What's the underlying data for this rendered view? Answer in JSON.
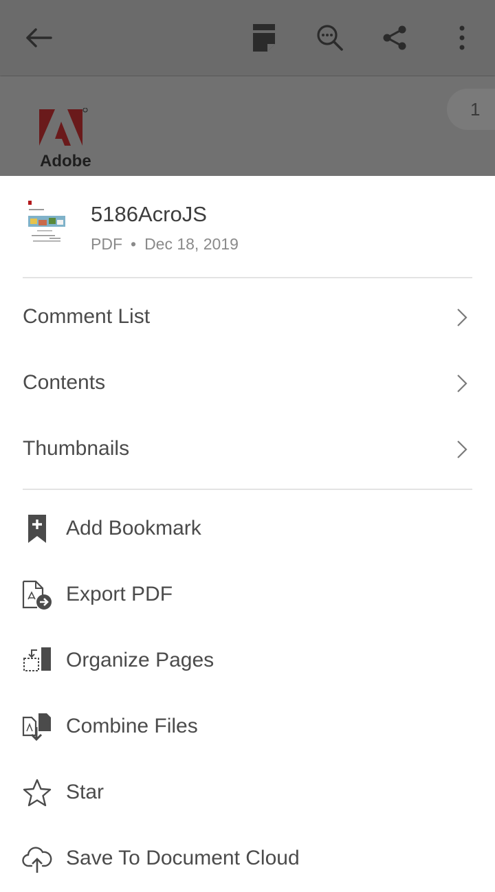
{
  "toolbar": {
    "back_icon": "arrow-left-icon",
    "icons": [
      "view-mode-icon",
      "search-icon",
      "share-icon",
      "more-vert-icon"
    ]
  },
  "document": {
    "logo_text": "Adobe",
    "page_number": "1"
  },
  "file": {
    "name": "5186AcroJS",
    "type": "PDF",
    "date": "Dec 18, 2019"
  },
  "nav_items": [
    {
      "label": "Comment List"
    },
    {
      "label": "Contents"
    },
    {
      "label": "Thumbnails"
    }
  ],
  "actions": [
    {
      "label": "Add Bookmark",
      "icon": "bookmark-add-icon"
    },
    {
      "label": "Export PDF",
      "icon": "export-pdf-icon"
    },
    {
      "label": "Organize Pages",
      "icon": "organize-pages-icon"
    },
    {
      "label": "Combine Files",
      "icon": "combine-files-icon"
    },
    {
      "label": "Star",
      "icon": "star-icon"
    },
    {
      "label": "Save To Document Cloud",
      "icon": "cloud-upload-icon"
    }
  ],
  "colors": {
    "overlay": "#6f6f6f",
    "text": "#4b4b4b",
    "meta": "#8a8a8a",
    "adobe_red": "#b3191c"
  }
}
